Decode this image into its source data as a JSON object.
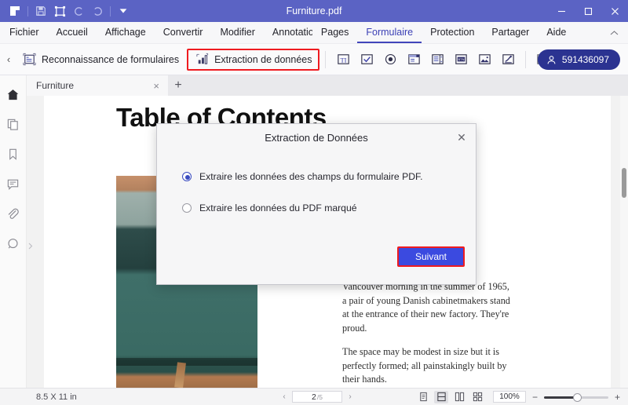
{
  "titlebar": {
    "title": "Furniture.pdf",
    "icons": [
      {
        "name": "app-logo-icon"
      },
      {
        "name": "save-icon"
      },
      {
        "name": "crop-resize-icon"
      },
      {
        "name": "undo-icon"
      },
      {
        "name": "redo-icon"
      },
      {
        "name": "customize-dropdown-icon"
      }
    ],
    "window_controls": [
      {
        "name": "minimize-button",
        "glyph": "─"
      },
      {
        "name": "maximize-button",
        "glyph": "□"
      },
      {
        "name": "close-button",
        "glyph": "✕"
      }
    ]
  },
  "menubar": {
    "items": [
      {
        "label": "Fichier",
        "active": false
      },
      {
        "label": "Accueil",
        "active": false
      },
      {
        "label": "Affichage",
        "active": false
      },
      {
        "label": "Convertir",
        "active": false
      },
      {
        "label": "Modifier",
        "active": false
      },
      {
        "label": "Annotation",
        "active": false
      },
      {
        "label": "Pages",
        "active": false
      },
      {
        "label": "Formulaire",
        "active": true
      },
      {
        "label": "Protection",
        "active": false
      },
      {
        "label": "Partager",
        "active": false
      },
      {
        "label": "Aide",
        "active": false
      }
    ]
  },
  "ribbon": {
    "back_glyph": "‹",
    "form_recognition_label": "Reconnaissance de formulaires",
    "data_extraction_label": "Extraction de données",
    "tools": [
      {
        "name": "text-field-icon"
      },
      {
        "name": "checkbox-field-icon"
      },
      {
        "name": "radio-button-field-icon"
      },
      {
        "name": "combo-box-field-icon"
      },
      {
        "name": "list-box-field-icon"
      },
      {
        "name": "push-button-field-icon"
      },
      {
        "name": "image-field-icon"
      },
      {
        "name": "signature-field-icon"
      },
      {
        "name": "more-tools-icon"
      }
    ],
    "user_id": "591436097",
    "accent_color": "#2b3391",
    "highlight_color": "#ef1b20"
  },
  "sidebar": {
    "items": [
      {
        "name": "home-icon",
        "label": "Accueil"
      },
      {
        "name": "pages-thumbnail-icon",
        "label": "Pages"
      },
      {
        "name": "bookmark-icon",
        "label": "Signets"
      },
      {
        "name": "comment-icon",
        "label": "Commentaires"
      },
      {
        "name": "attachment-icon",
        "label": "Pièces jointes"
      },
      {
        "name": "search-circle-icon",
        "label": "Recherche"
      }
    ]
  },
  "tabstrip": {
    "tab_label": "Furniture",
    "close_glyph": "×",
    "add_glyph": "+"
  },
  "document": {
    "page_title": "Table of Contents",
    "paragraphs": [
      "Vancouver morning in the summer of 1965, a pair of young Danish cabinetmakers stand at the entrance of their new factory. They're proud.",
      "The space may be modest in size but it is perfectly formed; all painstakingly built by their hands."
    ]
  },
  "statusbar": {
    "page_size": "8.5 X 11 in",
    "prev_glyph": "‹",
    "next_glyph": "›",
    "current_page": "2",
    "total_pages": "/5",
    "view_modes": [
      {
        "name": "single-page-view-icon",
        "selected": false
      },
      {
        "name": "continuous-scroll-view-icon",
        "selected": true
      },
      {
        "name": "two-page-view-icon",
        "selected": false
      },
      {
        "name": "grid-view-icon",
        "selected": false
      }
    ],
    "zoom_level": "100%",
    "zoom_out_glyph": "−",
    "zoom_in_glyph": "+"
  },
  "dialog": {
    "title": "Extraction de Données",
    "close_glyph": "✕",
    "options": [
      {
        "label": "Extraire les données des champs du formulaire PDF.",
        "selected": true
      },
      {
        "label": "Extraire les données du PDF marqué",
        "selected": false
      }
    ],
    "next_label": "Suivant",
    "button_color": "#3b4ae0",
    "highlight_color": "#ef1b20"
  }
}
